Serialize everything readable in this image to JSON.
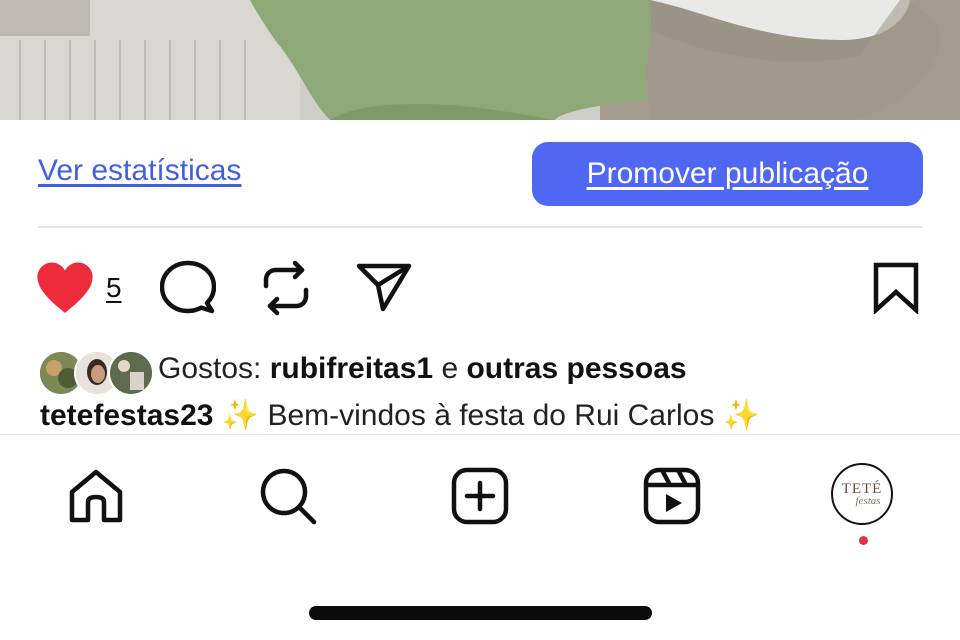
{
  "post": {
    "image_desc_colors": {
      "wall": "#c9c8c3",
      "cloth": "#8fa877",
      "chair": "#e8e8e6",
      "floor": "#9c9488"
    }
  },
  "insights": {
    "view_stats_label": "Ver estatísticas",
    "promote_label": "Promover publicação",
    "accent_color": "#4f67f2"
  },
  "actions": {
    "like_count": "5",
    "liked": true,
    "like_color": "#ee2b3b",
    "icons": [
      "heart-icon",
      "comment-icon",
      "repost-icon",
      "share-icon",
      "bookmark-icon"
    ]
  },
  "likes": {
    "prefix": "Gostos: ",
    "user": "rubifreitas1",
    "connector": " e ",
    "others": "outras pessoas"
  },
  "caption": {
    "username": "tetefestas23",
    "text": " ✨ Bem-vindos à festa do Rui Carlos ✨"
  },
  "bottom_nav": {
    "items": [
      "home-icon",
      "search-icon",
      "create-icon",
      "reels-icon",
      "profile-avatar"
    ],
    "profile_logo_main": "TETÉ",
    "profile_logo_sub": "festas",
    "notification_dot_color": "#e8313f"
  }
}
